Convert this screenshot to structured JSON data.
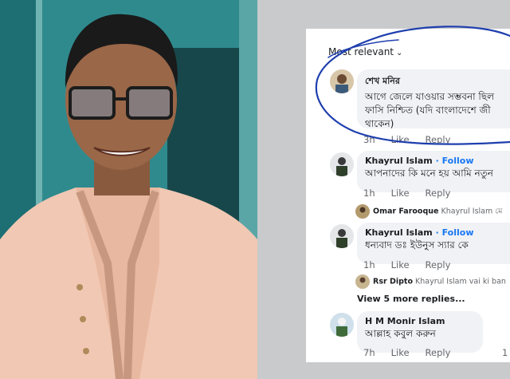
{
  "panel": {
    "sort_label": "Most relevant",
    "comments": [
      {
        "name": "শেখ মনির",
        "lines": [
          "আগে জেলে যাওয়ার সম্ভবনা ছিল",
          "ফাসি নিশ্চিত (যদি বাংলাদেশে জী",
          "থাকেন)"
        ],
        "time": "3h",
        "like": "Like",
        "reply": "Reply"
      },
      {
        "name": "Khayrul Islam",
        "follow": "· Follow",
        "text": "আপনাদের কি মনে হয় আমি নতুন",
        "time": "1h",
        "like": "Like",
        "reply": "Reply",
        "sub_reply": {
          "name": "Omar Farooque",
          "text": "Khayrul Islam মে"
        }
      },
      {
        "name": "Khayrul Islam",
        "follow": "· Follow",
        "text": "ধন্যবাদ ডঃ ইউনুস স্যার কে",
        "time": "1h",
        "like": "Like",
        "reply": "Reply",
        "sub_reply": {
          "name": "Rsr Dipto",
          "text": "Khayrul Islam vai ki ban"
        },
        "view_more": "View 5 more replies..."
      },
      {
        "name": "H M Monir Islam",
        "text": "আল্লাহ কবুল করুন",
        "time": "7h",
        "like": "Like",
        "reply": "Reply",
        "count": "1"
      }
    ]
  },
  "colors": {
    "link": "#1877f2",
    "annotation": "#1f3fae",
    "bubble": "#f0f2f5",
    "photo_bg": "#2f8a8e",
    "page_bg": "#c9cacc"
  },
  "icons": {
    "sort": "chevron-down-icon"
  }
}
